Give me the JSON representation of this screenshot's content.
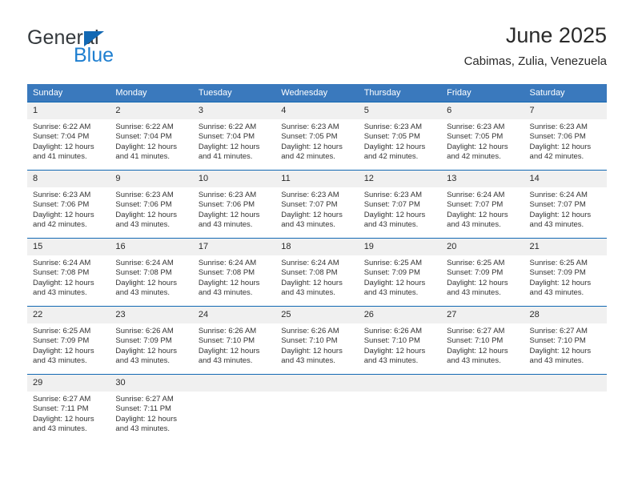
{
  "brand": {
    "word1": "General",
    "word2": "Blue",
    "flag_icon": "blue-triangle-flag-icon",
    "color_dark": "#34393d",
    "color_blue": "#1f7fd0"
  },
  "header": {
    "title": "June 2025",
    "subtitle": "Cabimas, Zulia, Venezuela"
  },
  "theme": {
    "header_bg": "#3a79bd",
    "row_border": "#1268b3",
    "daynum_bg": "#f0f0f0",
    "text": "#333333"
  },
  "weekdays": [
    "Sunday",
    "Monday",
    "Tuesday",
    "Wednesday",
    "Thursday",
    "Friday",
    "Saturday"
  ],
  "weeks": [
    [
      {
        "day": "1",
        "sunrise": "Sunrise: 6:22 AM",
        "sunset": "Sunset: 7:04 PM",
        "daylight1": "Daylight: 12 hours",
        "daylight2": "and 41 minutes."
      },
      {
        "day": "2",
        "sunrise": "Sunrise: 6:22 AM",
        "sunset": "Sunset: 7:04 PM",
        "daylight1": "Daylight: 12 hours",
        "daylight2": "and 41 minutes."
      },
      {
        "day": "3",
        "sunrise": "Sunrise: 6:22 AM",
        "sunset": "Sunset: 7:04 PM",
        "daylight1": "Daylight: 12 hours",
        "daylight2": "and 41 minutes."
      },
      {
        "day": "4",
        "sunrise": "Sunrise: 6:23 AM",
        "sunset": "Sunset: 7:05 PM",
        "daylight1": "Daylight: 12 hours",
        "daylight2": "and 42 minutes."
      },
      {
        "day": "5",
        "sunrise": "Sunrise: 6:23 AM",
        "sunset": "Sunset: 7:05 PM",
        "daylight1": "Daylight: 12 hours",
        "daylight2": "and 42 minutes."
      },
      {
        "day": "6",
        "sunrise": "Sunrise: 6:23 AM",
        "sunset": "Sunset: 7:05 PM",
        "daylight1": "Daylight: 12 hours",
        "daylight2": "and 42 minutes."
      },
      {
        "day": "7",
        "sunrise": "Sunrise: 6:23 AM",
        "sunset": "Sunset: 7:06 PM",
        "daylight1": "Daylight: 12 hours",
        "daylight2": "and 42 minutes."
      }
    ],
    [
      {
        "day": "8",
        "sunrise": "Sunrise: 6:23 AM",
        "sunset": "Sunset: 7:06 PM",
        "daylight1": "Daylight: 12 hours",
        "daylight2": "and 42 minutes."
      },
      {
        "day": "9",
        "sunrise": "Sunrise: 6:23 AM",
        "sunset": "Sunset: 7:06 PM",
        "daylight1": "Daylight: 12 hours",
        "daylight2": "and 43 minutes."
      },
      {
        "day": "10",
        "sunrise": "Sunrise: 6:23 AM",
        "sunset": "Sunset: 7:06 PM",
        "daylight1": "Daylight: 12 hours",
        "daylight2": "and 43 minutes."
      },
      {
        "day": "11",
        "sunrise": "Sunrise: 6:23 AM",
        "sunset": "Sunset: 7:07 PM",
        "daylight1": "Daylight: 12 hours",
        "daylight2": "and 43 minutes."
      },
      {
        "day": "12",
        "sunrise": "Sunrise: 6:23 AM",
        "sunset": "Sunset: 7:07 PM",
        "daylight1": "Daylight: 12 hours",
        "daylight2": "and 43 minutes."
      },
      {
        "day": "13",
        "sunrise": "Sunrise: 6:24 AM",
        "sunset": "Sunset: 7:07 PM",
        "daylight1": "Daylight: 12 hours",
        "daylight2": "and 43 minutes."
      },
      {
        "day": "14",
        "sunrise": "Sunrise: 6:24 AM",
        "sunset": "Sunset: 7:07 PM",
        "daylight1": "Daylight: 12 hours",
        "daylight2": "and 43 minutes."
      }
    ],
    [
      {
        "day": "15",
        "sunrise": "Sunrise: 6:24 AM",
        "sunset": "Sunset: 7:08 PM",
        "daylight1": "Daylight: 12 hours",
        "daylight2": "and 43 minutes."
      },
      {
        "day": "16",
        "sunrise": "Sunrise: 6:24 AM",
        "sunset": "Sunset: 7:08 PM",
        "daylight1": "Daylight: 12 hours",
        "daylight2": "and 43 minutes."
      },
      {
        "day": "17",
        "sunrise": "Sunrise: 6:24 AM",
        "sunset": "Sunset: 7:08 PM",
        "daylight1": "Daylight: 12 hours",
        "daylight2": "and 43 minutes."
      },
      {
        "day": "18",
        "sunrise": "Sunrise: 6:24 AM",
        "sunset": "Sunset: 7:08 PM",
        "daylight1": "Daylight: 12 hours",
        "daylight2": "and 43 minutes."
      },
      {
        "day": "19",
        "sunrise": "Sunrise: 6:25 AM",
        "sunset": "Sunset: 7:09 PM",
        "daylight1": "Daylight: 12 hours",
        "daylight2": "and 43 minutes."
      },
      {
        "day": "20",
        "sunrise": "Sunrise: 6:25 AM",
        "sunset": "Sunset: 7:09 PM",
        "daylight1": "Daylight: 12 hours",
        "daylight2": "and 43 minutes."
      },
      {
        "day": "21",
        "sunrise": "Sunrise: 6:25 AM",
        "sunset": "Sunset: 7:09 PM",
        "daylight1": "Daylight: 12 hours",
        "daylight2": "and 43 minutes."
      }
    ],
    [
      {
        "day": "22",
        "sunrise": "Sunrise: 6:25 AM",
        "sunset": "Sunset: 7:09 PM",
        "daylight1": "Daylight: 12 hours",
        "daylight2": "and 43 minutes."
      },
      {
        "day": "23",
        "sunrise": "Sunrise: 6:26 AM",
        "sunset": "Sunset: 7:09 PM",
        "daylight1": "Daylight: 12 hours",
        "daylight2": "and 43 minutes."
      },
      {
        "day": "24",
        "sunrise": "Sunrise: 6:26 AM",
        "sunset": "Sunset: 7:10 PM",
        "daylight1": "Daylight: 12 hours",
        "daylight2": "and 43 minutes."
      },
      {
        "day": "25",
        "sunrise": "Sunrise: 6:26 AM",
        "sunset": "Sunset: 7:10 PM",
        "daylight1": "Daylight: 12 hours",
        "daylight2": "and 43 minutes."
      },
      {
        "day": "26",
        "sunrise": "Sunrise: 6:26 AM",
        "sunset": "Sunset: 7:10 PM",
        "daylight1": "Daylight: 12 hours",
        "daylight2": "and 43 minutes."
      },
      {
        "day": "27",
        "sunrise": "Sunrise: 6:27 AM",
        "sunset": "Sunset: 7:10 PM",
        "daylight1": "Daylight: 12 hours",
        "daylight2": "and 43 minutes."
      },
      {
        "day": "28",
        "sunrise": "Sunrise: 6:27 AM",
        "sunset": "Sunset: 7:10 PM",
        "daylight1": "Daylight: 12 hours",
        "daylight2": "and 43 minutes."
      }
    ],
    [
      {
        "day": "29",
        "sunrise": "Sunrise: 6:27 AM",
        "sunset": "Sunset: 7:11 PM",
        "daylight1": "Daylight: 12 hours",
        "daylight2": "and 43 minutes."
      },
      {
        "day": "30",
        "sunrise": "Sunrise: 6:27 AM",
        "sunset": "Sunset: 7:11 PM",
        "daylight1": "Daylight: 12 hours",
        "daylight2": "and 43 minutes."
      },
      {
        "day": "",
        "sunrise": "",
        "sunset": "",
        "daylight1": "",
        "daylight2": ""
      },
      {
        "day": "",
        "sunrise": "",
        "sunset": "",
        "daylight1": "",
        "daylight2": ""
      },
      {
        "day": "",
        "sunrise": "",
        "sunset": "",
        "daylight1": "",
        "daylight2": ""
      },
      {
        "day": "",
        "sunrise": "",
        "sunset": "",
        "daylight1": "",
        "daylight2": ""
      },
      {
        "day": "",
        "sunrise": "",
        "sunset": "",
        "daylight1": "",
        "daylight2": ""
      }
    ]
  ]
}
